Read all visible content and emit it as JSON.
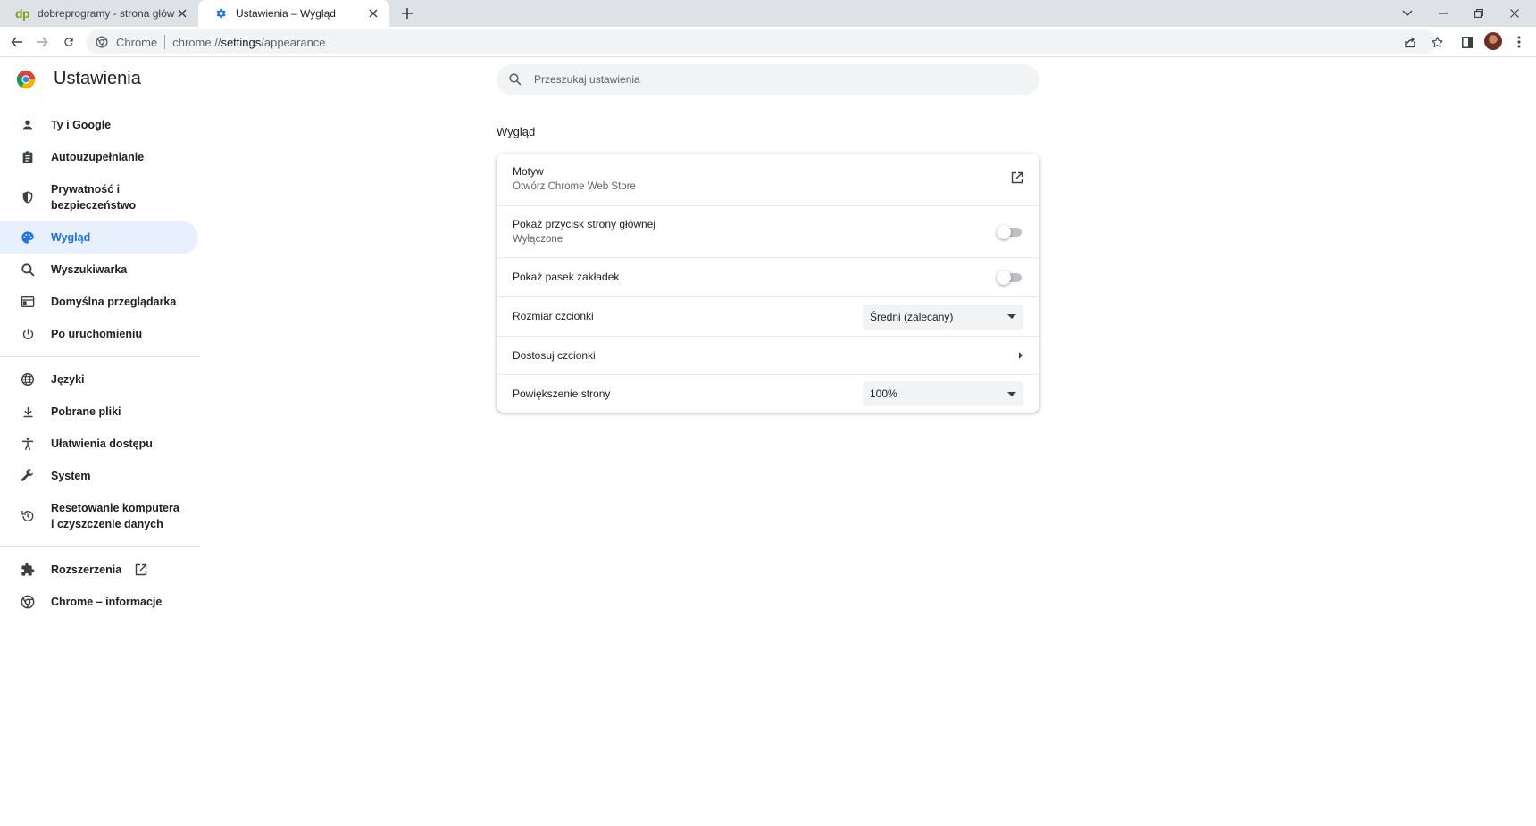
{
  "tabs": [
    {
      "title": "dobreprogramy - strona główna",
      "favicon": "dp-logo",
      "active": false
    },
    {
      "title": "Ustawienia – Wygląd",
      "favicon": "gear-icon",
      "active": true
    }
  ],
  "toolbar": {
    "site_chip": "Chrome",
    "url_scheme": "chrome://",
    "url_host": "settings",
    "url_path": "/appearance"
  },
  "settings": {
    "title": "Ustawienia",
    "search_placeholder": "Przeszukaj ustawienia"
  },
  "sidebar": {
    "items": [
      {
        "label": "Ty i Google",
        "icon": "person-icon"
      },
      {
        "label": "Autouzupełnianie",
        "icon": "clipboard-icon"
      },
      {
        "label": "Prywatność i\nbezpieczeństwo",
        "icon": "shield-icon"
      },
      {
        "label": "Wygląd",
        "icon": "palette-icon",
        "active": true
      },
      {
        "label": "Wyszukiwarka",
        "icon": "search-icon"
      },
      {
        "label": "Domyślna przeglądarka",
        "icon": "browser-icon"
      },
      {
        "label": "Po uruchomieniu",
        "icon": "power-icon"
      },
      {
        "label": "Języki",
        "icon": "globe-icon"
      },
      {
        "label": "Pobrane pliki",
        "icon": "download-icon"
      },
      {
        "label": "Ułatwienia dostępu",
        "icon": "accessibility-icon"
      },
      {
        "label": "System",
        "icon": "wrench-icon"
      },
      {
        "label": "Resetowanie komputera\ni czyszczenie danych",
        "icon": "restore-icon"
      },
      {
        "label": "Rozszerzenia",
        "icon": "puzzle-icon"
      },
      {
        "label": "Chrome – informacje",
        "icon": "chrome-icon"
      }
    ]
  },
  "appearance": {
    "section_title": "Wygląd",
    "theme_label": "Motyw",
    "theme_sub": "Otwórz Chrome Web Store",
    "home_button_label": "Pokaż przycisk strony głównej",
    "home_button_sub": "Wyłączone",
    "home_button_on": false,
    "bookmarks_bar_label": "Pokaż pasek zakładek",
    "bookmarks_bar_on": false,
    "font_size_label": "Rozmiar czcionki",
    "font_size_value": "Średni (zalecany)",
    "customize_fonts_label": "Dostosuj czcionki",
    "page_zoom_label": "Powiększenie strony",
    "page_zoom_value": "100%"
  },
  "colors": {
    "accent": "#1a73e8",
    "active_nav_bg": "#e8f0fe",
    "tabstrip_bg": "#dee1e6"
  }
}
